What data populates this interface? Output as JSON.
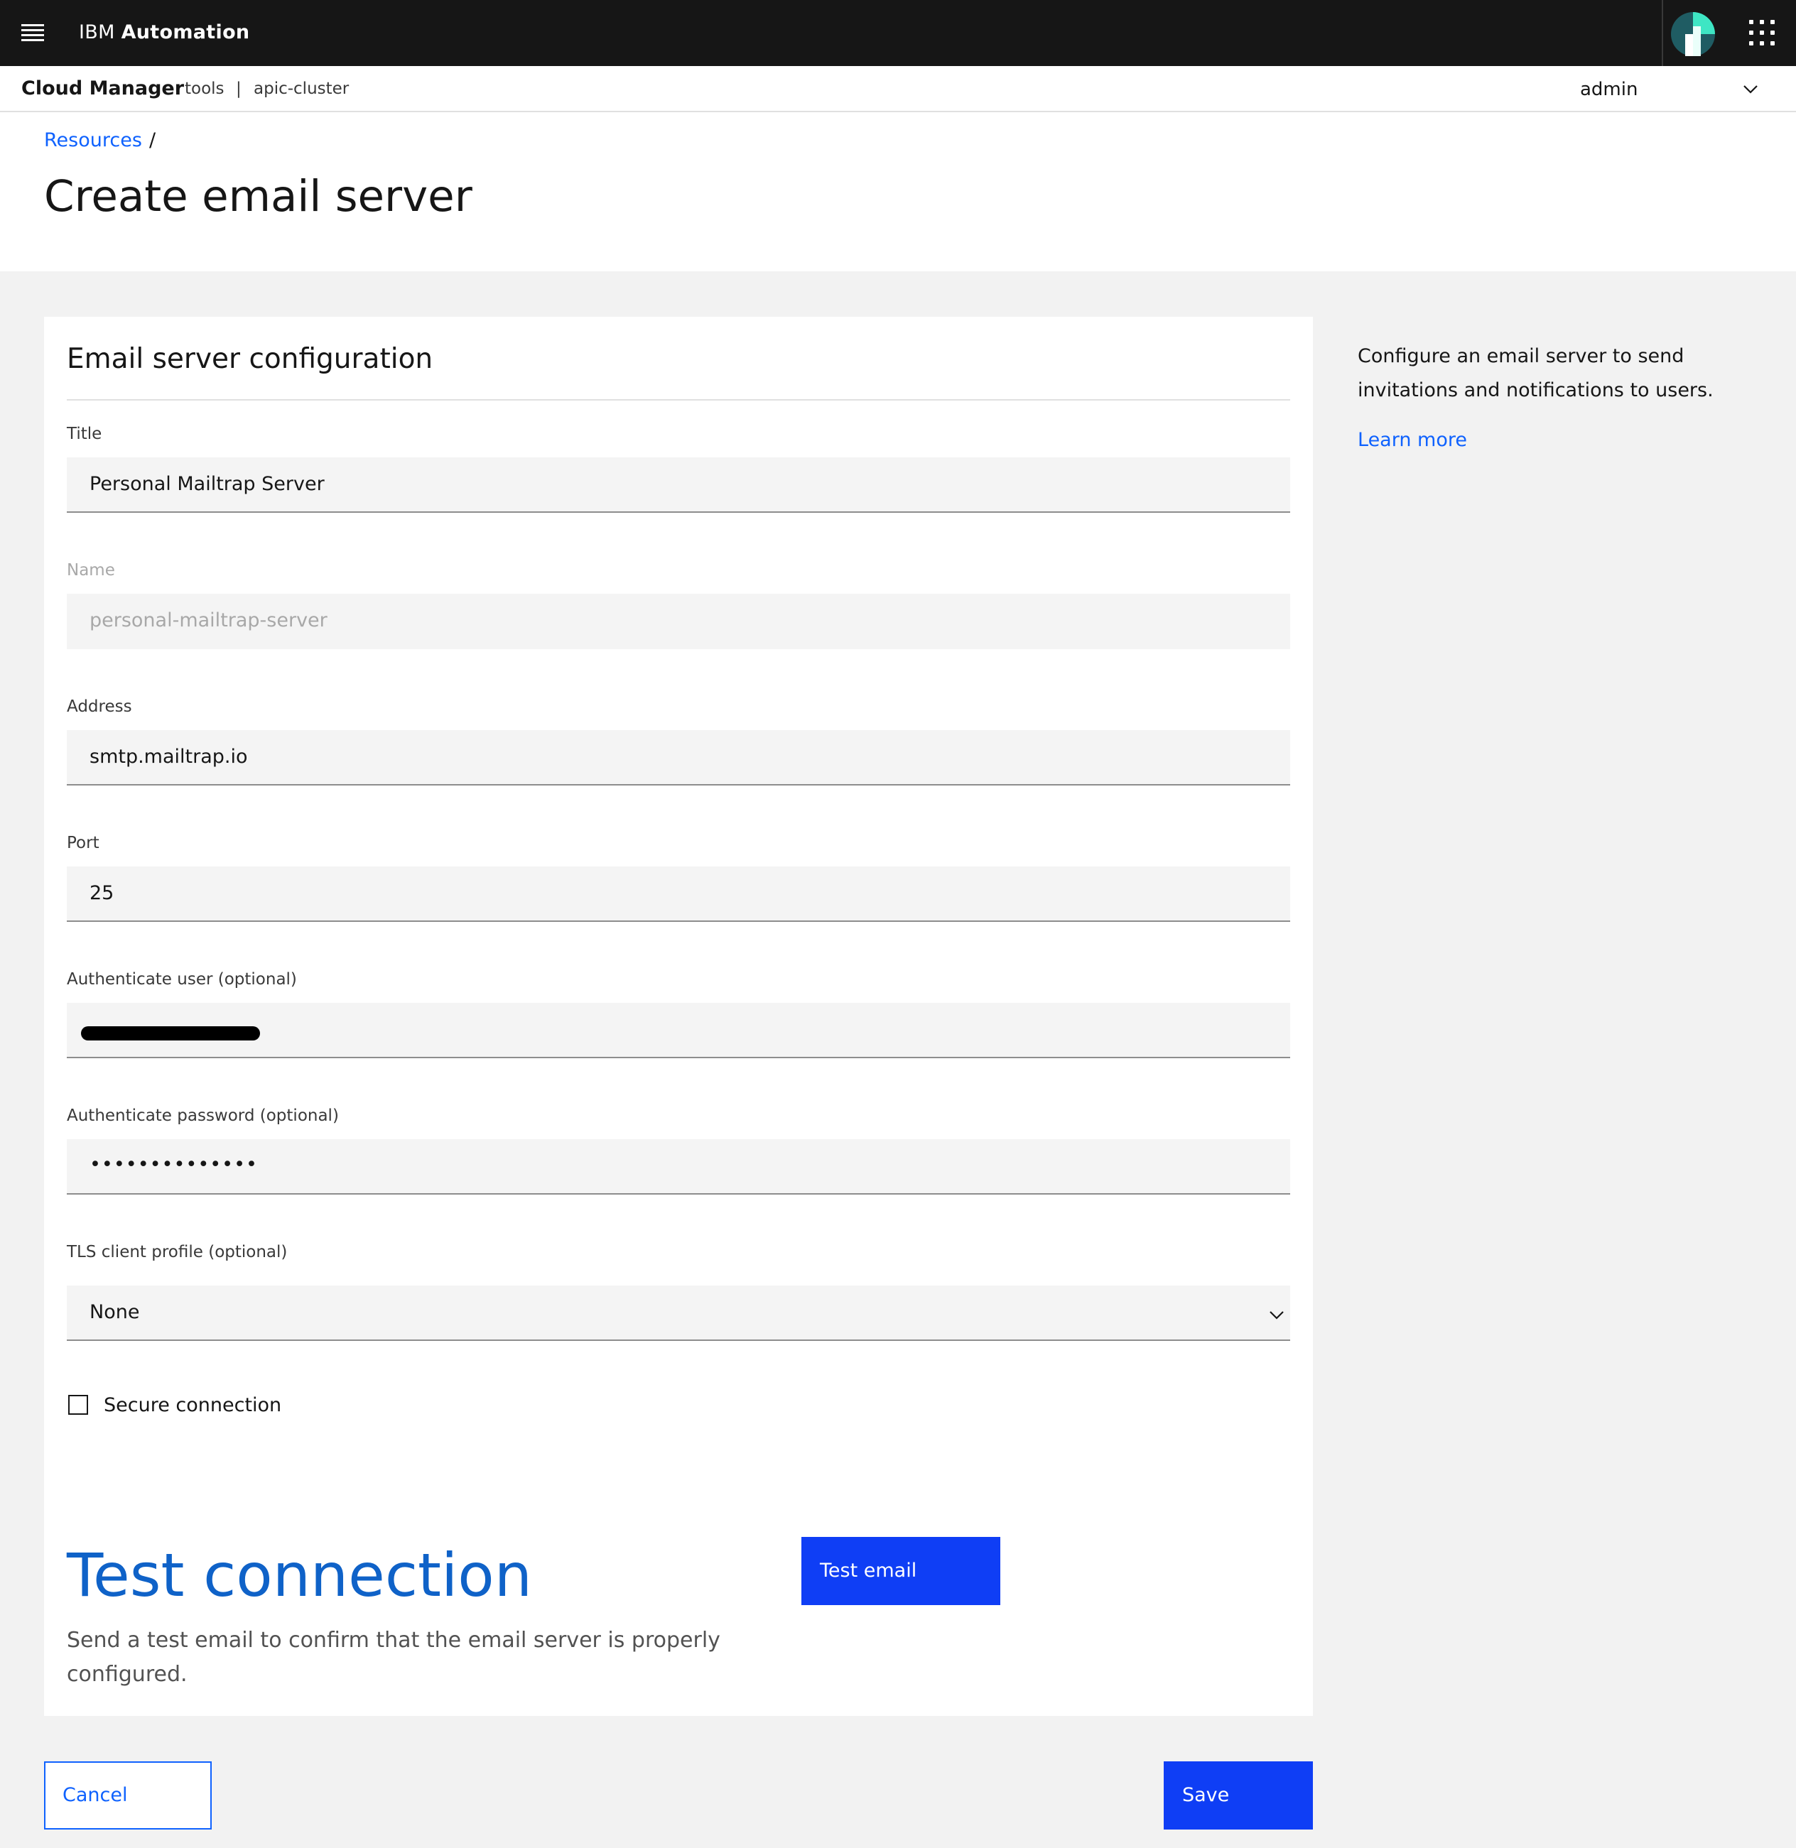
{
  "header": {
    "brand_prefix": "IBM",
    "brand_name": "Automation",
    "product": "Cloud Manager",
    "context_provider": "tools",
    "context_separator": "|",
    "context_cluster": "apic-cluster",
    "user": "admin",
    "icons": [
      "menu-icon",
      "app-logo-icon",
      "app-switcher-icon",
      "chevron-down-icon"
    ]
  },
  "breadcrumb": {
    "items": [
      "Resources"
    ],
    "separator": "/"
  },
  "page": {
    "title": "Create email server"
  },
  "form": {
    "section_title": "Email server configuration",
    "fields": {
      "title": {
        "label": "Title",
        "value": "Personal Mailtrap Server"
      },
      "name": {
        "label": "Name",
        "value": "personal-mailtrap-server",
        "disabled": true
      },
      "address": {
        "label": "Address",
        "value": "smtp.mailtrap.io"
      },
      "port": {
        "label": "Port",
        "value": "25"
      },
      "auth_user": {
        "label": "Authenticate user (optional)",
        "value": "",
        "redacted": true
      },
      "auth_password": {
        "label": "Authenticate password (optional)",
        "value": "••••••••••••••"
      },
      "tls_profile": {
        "label": "TLS client profile (optional)",
        "value": "None"
      }
    },
    "secure_connection": {
      "label": "Secure connection",
      "checked": false
    }
  },
  "test": {
    "title": "Test connection",
    "description": "Send a test email to confirm that the email server is properly configured.",
    "button_label": "Test email"
  },
  "actions": {
    "cancel_label": "Cancel",
    "save_label": "Save"
  },
  "sidebar": {
    "help_text": "Configure an email server to send invitations and notifications to users.",
    "learn_more": "Learn more"
  },
  "colors": {
    "topbar": "#161616",
    "primary": "#0f3ef5",
    "link": "#0f62fe",
    "heading_blue": "#0f62c8",
    "page_bg": "#f2f2f2",
    "field_bg": "#f4f4f4"
  }
}
